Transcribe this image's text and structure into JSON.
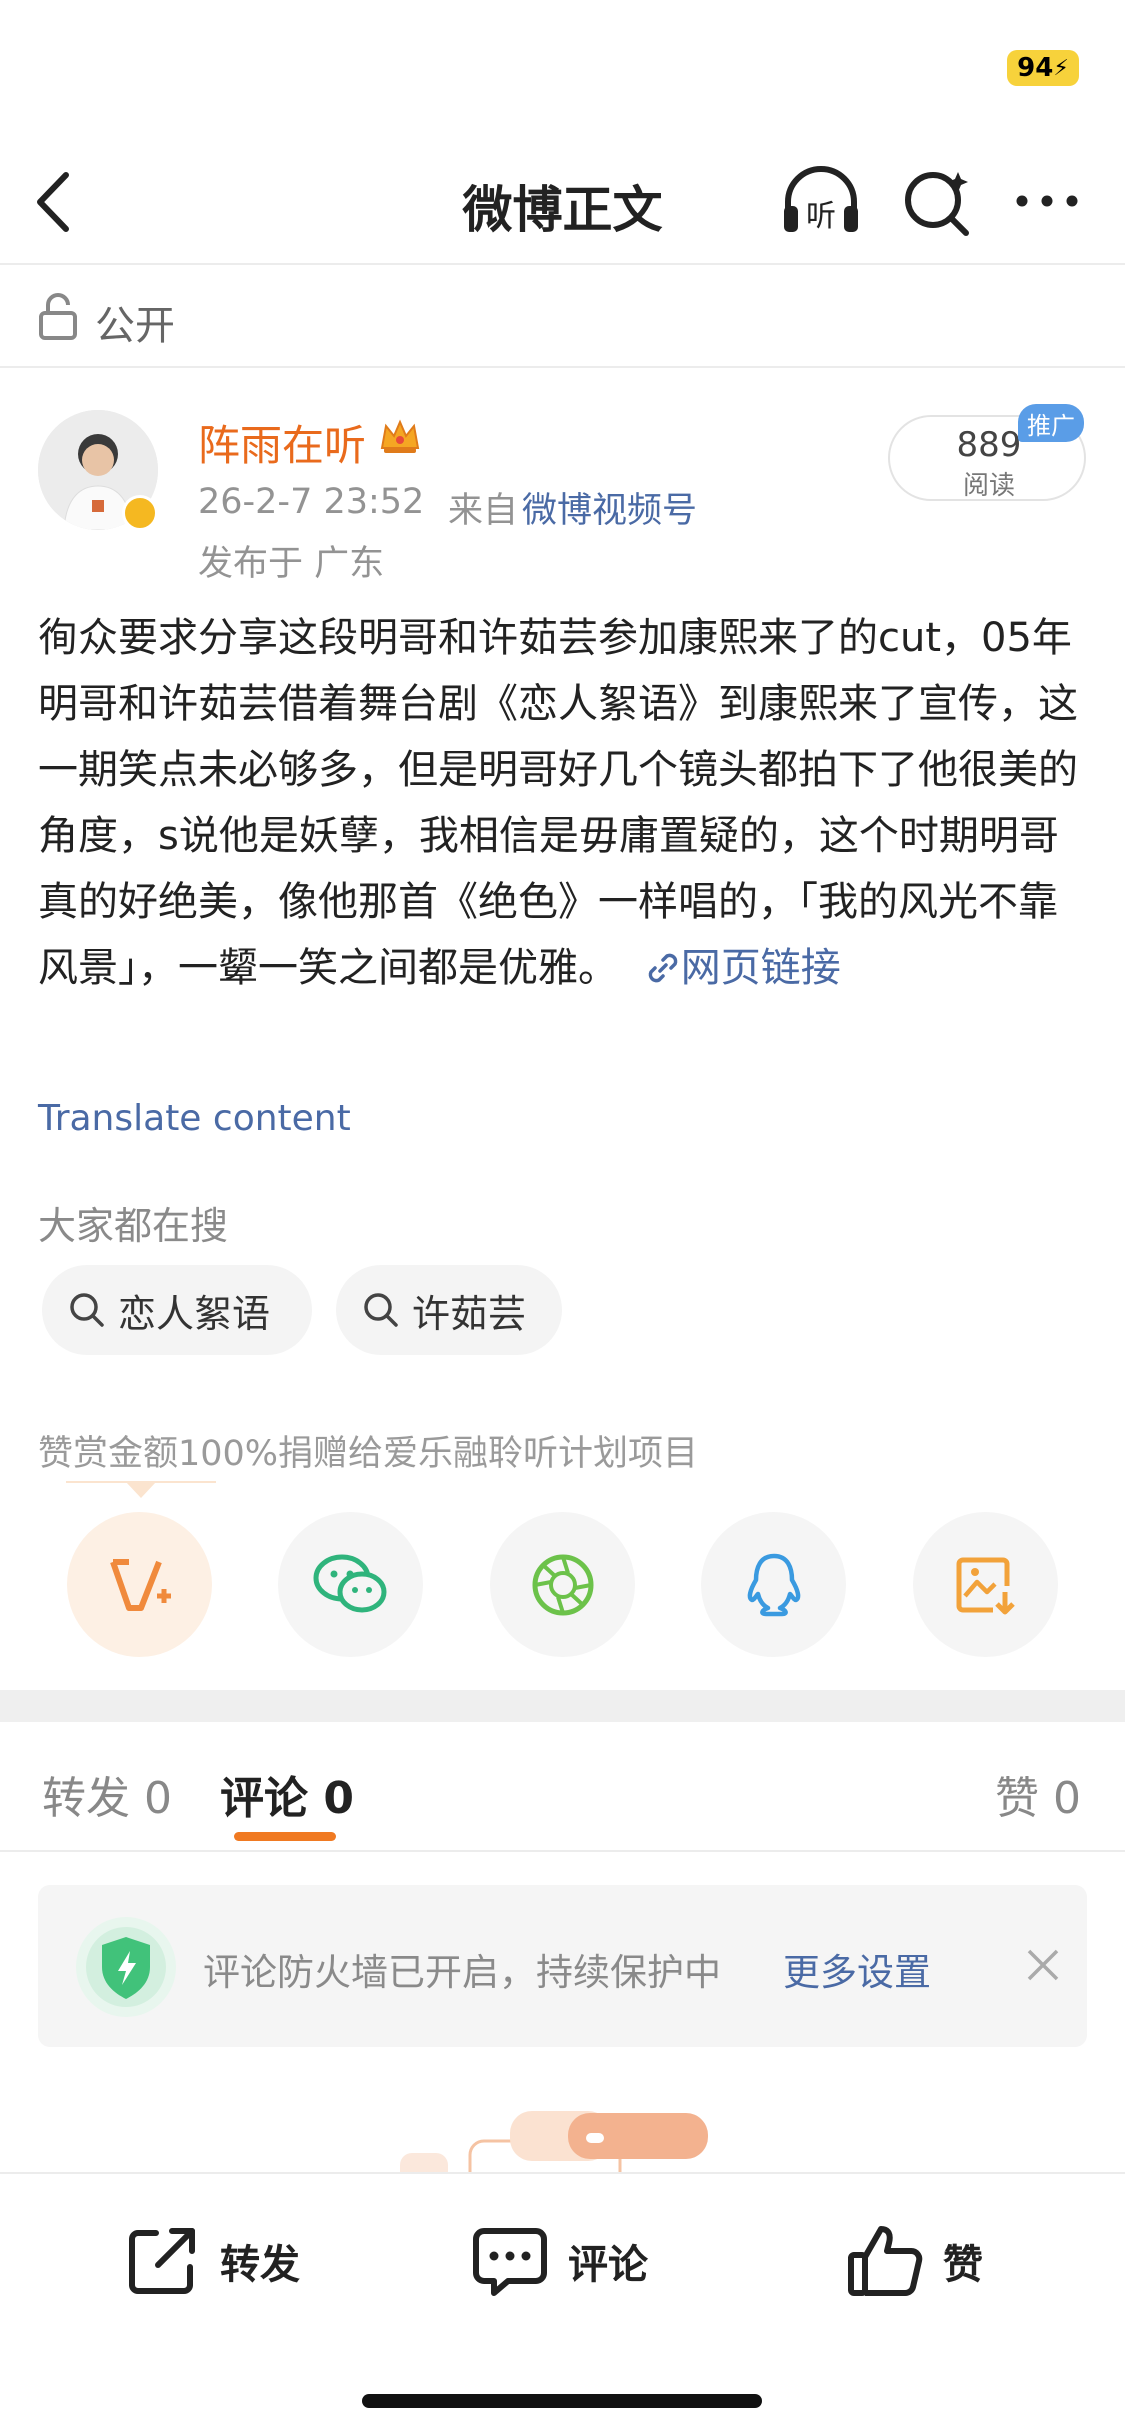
{
  "status_bar": {
    "battery": "94"
  },
  "nav": {
    "title": "微博正文",
    "listen_label": "听"
  },
  "visibility": {
    "label": "公开"
  },
  "post": {
    "author": "阵雨在听",
    "time": "26-2-7 23:52",
    "from_prefix": "来自",
    "source": "微博视频号",
    "location": "发布于 广东",
    "read_count": "889",
    "read_label": "阅读",
    "promo_tag": "推广",
    "body": "徇众要求分享这段明哥和许茹芸参加康熙来了的cut，05年明哥和许茹芸借着舞台剧《恋人絮语》到康熙来了宣传，这一期笑点未必够多，但是明哥好几个镜头都拍下了他很美的角度，s说他是妖孽，我相信是毋庸置疑的，这个时期明哥真的好绝美，像他那首《绝色》一样唱的，「我的风光不靠风景」，一颦一笑之间都是优雅。",
    "web_link": "网页链接",
    "translate": "Translate content"
  },
  "hot_search": {
    "title": "大家都在搜",
    "items": [
      "恋人絮语",
      "许茹芸"
    ]
  },
  "reward": {
    "text": "赞赏金额100%捐赠给爱乐融聆听计划项目"
  },
  "share": {
    "icons": [
      "v-plus-icon",
      "wechat-icon",
      "moments-icon",
      "qq-icon",
      "save-image-icon"
    ]
  },
  "tabs": {
    "repost": "转发 0",
    "comment": "评论 0",
    "like": "赞 0"
  },
  "firewall": {
    "text": "评论防火墙已开启，持续保护中",
    "link": "更多设置"
  },
  "bottom_bar": {
    "repost": "转发",
    "comment": "评论",
    "like": "赞"
  },
  "colors": {
    "accent_orange": "#f07a22",
    "link_blue": "#4a6aa5",
    "author_orange": "#e96a1c"
  }
}
